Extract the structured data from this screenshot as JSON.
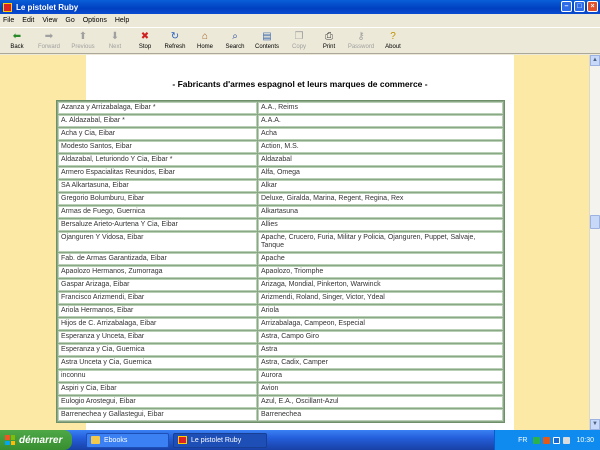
{
  "window": {
    "title": "Le pistolet Ruby"
  },
  "menu": [
    "File",
    "Edit",
    "View",
    "Go",
    "Options",
    "Help"
  ],
  "toolbar": [
    {
      "label": "Back",
      "icon": "back-arrow-icon",
      "enabled": true
    },
    {
      "label": "Forward",
      "icon": "forward-arrow-icon",
      "enabled": false
    },
    {
      "label": "Previous",
      "icon": "up-arrow-icon",
      "enabled": false
    },
    {
      "label": "Next",
      "icon": "down-arrow-icon",
      "enabled": false
    },
    {
      "label": "Stop",
      "icon": "stop-icon",
      "enabled": true
    },
    {
      "label": "Refresh",
      "icon": "refresh-icon",
      "enabled": true
    },
    {
      "label": "Home",
      "icon": "home-icon",
      "enabled": true
    },
    {
      "label": "Search",
      "icon": "search-icon",
      "enabled": true
    },
    {
      "label": "Contents",
      "icon": "contents-icon",
      "enabled": true
    },
    {
      "label": "Copy",
      "icon": "copy-icon",
      "enabled": false
    },
    {
      "label": "Print",
      "icon": "print-icon",
      "enabled": true
    },
    {
      "label": "Password",
      "icon": "key-icon",
      "enabled": false
    },
    {
      "label": "About",
      "icon": "about-icon",
      "enabled": true
    }
  ],
  "page": {
    "heading": "- Fabricants d'armes espagnol et leurs marques de commerce -",
    "rows": [
      [
        "Azanza y Arrizabalaga, Eibar *",
        "A.A., Reims"
      ],
      [
        "A. Aldazabal, Eibar *",
        "A.A.A."
      ],
      [
        "Acha y Cia, Eibar",
        "Acha"
      ],
      [
        "Modesto Santos, Eibar",
        "Action, M.S."
      ],
      [
        "Aldazabal, Leturiondo Y Cia, Eibar *",
        "Aldazabal"
      ],
      [
        "Armero Espacialitas Reunidos, Eibar",
        "Alfa, Omega"
      ],
      [
        "SA Alkartasuna, Eibar",
        "Alkar"
      ],
      [
        "Gregorio Bolumburu, Eibar",
        "Deluxe, Giralda, Marina, Regent, Regina, Rex"
      ],
      [
        "Armas de Fuego, Guernica",
        "Alkartasuna"
      ],
      [
        "Bersaluze Arieto-Aurtena Y Cia, Eibar",
        "Allies"
      ],
      [
        "Ojanguren Y Vidosa, Eibar",
        "Apache, Crucero, Furia, Militar y Policia, Ojanguren, Puppet, Salvaje, Tanque"
      ],
      [
        "Fab. de Armas Garantizada, Eibar",
        "Apache"
      ],
      [
        "Apaolozo Hermanos, Zumorraga",
        "Apaolozo, Triomphe"
      ],
      [
        "Gaspar Arizaga, Eibar",
        "Arizaga, Mondial, Pinkerton, Warwinck"
      ],
      [
        "Francisco Arizmendi, Eibar",
        "Arizmendi, Roland, Singer, Victor, Ydeal"
      ],
      [
        "Ariola Hermanos, Eibar",
        "Ariola"
      ],
      [
        "Hijos de C. Arrizabalaga, Eibar",
        "Arrizabalaga, Campeon, Especial"
      ],
      [
        "Esperanza y Unceta, Eibar",
        "Astra, Campo Giro"
      ],
      [
        "Esperanza y Cia, Guernica",
        "Astra"
      ],
      [
        "Astra Unceta y Cia, Guernica",
        "Astra, Cadix, Camper"
      ],
      [
        "inconnu",
        "Aurora"
      ],
      [
        "Aspiri y Cia, Eibar",
        "Avion"
      ],
      [
        "Eulogio Arostegui, Eibar",
        "Azul, E.A., Oscillant-Azul"
      ],
      [
        "Barrenechea y Gallastegui, Eibar",
        "Barrenechea"
      ]
    ]
  },
  "taskbar": {
    "start_label": "démarrer",
    "tasks": [
      {
        "label": "Ebooks",
        "active": false
      },
      {
        "label": "Le pistolet Ruby",
        "active": true
      }
    ],
    "language": "FR",
    "clock": "10:30"
  },
  "colors": {
    "side_band": "#fbe9a5",
    "table_border": "#8aa886"
  }
}
